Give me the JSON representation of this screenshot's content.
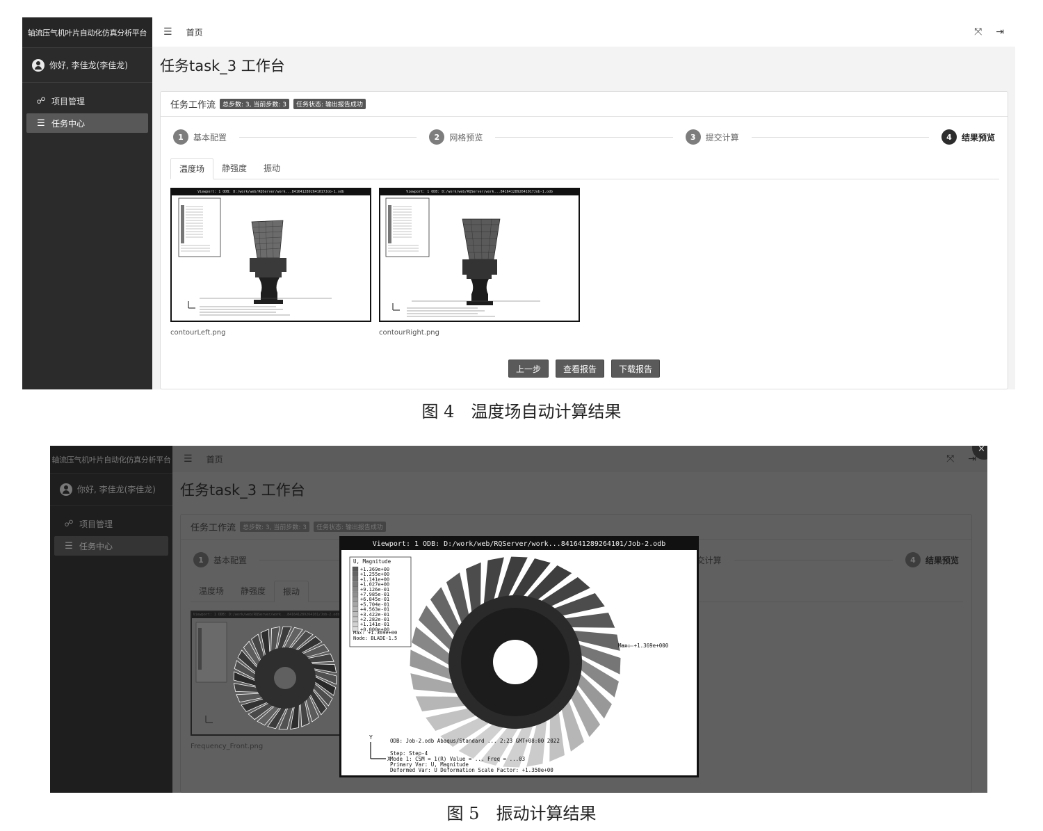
{
  "app": {
    "platform_title": "轴流压气机叶片自动化仿真分析平台",
    "user_greeting": "你好, 李佳龙(李佳龙)",
    "menu": [
      {
        "label": "项目管理",
        "icon": "tree-structure-icon"
      },
      {
        "label": "任务中心",
        "icon": "list-icon"
      }
    ],
    "topbar": {
      "home_label": "首页",
      "menu_icon": "hamburger-icon",
      "fullscreen_icon": "fullscreen-icon",
      "logout_icon": "logout-icon"
    },
    "page_title": "任务task_3 工作台",
    "workflow": {
      "title": "任务工作流",
      "badge_steps": "总步数: 3, 当前步数: 3",
      "badge_status": "任务状态: 输出报告成功"
    },
    "steps": [
      {
        "num": "1",
        "label": "基本配置"
      },
      {
        "num": "2",
        "label": "网格预览"
      },
      {
        "num": "3",
        "label": "提交计算"
      },
      {
        "num": "4",
        "label": "结果预览"
      }
    ],
    "tabs": [
      "温度场",
      "静强度",
      "振动"
    ],
    "buttons": {
      "prev": "上一步",
      "view_report": "查看报告",
      "download_report": "下载报告"
    }
  },
  "figure4": {
    "active_tab": "温度场",
    "images": [
      {
        "caption": "contourLeft.png",
        "viewport": "Viewport: 1    ODB: D:/work/web/RQServer/work...8416412892641017Job-1.odb"
      },
      {
        "caption": "contourRight.png",
        "viewport": "Viewport: 1    ODB: D:/work/web/RQServer/work...8416412892641017Job-1.odb"
      }
    ],
    "caption": "图 4　温度场自动计算结果"
  },
  "figure5": {
    "active_tab": "振动",
    "thumb_caption": "Frequency_Front.png",
    "close_label": "×",
    "modal": {
      "viewport": "Viewport: 1    ODB: D:/work/web/RQServer/work...841641289264101/Job-2.odb",
      "legend_title": "U, Magnitude",
      "legend_values": [
        "+1.369e+00",
        "+1.255e+00",
        "+1.141e+00",
        "+1.027e+00",
        "+9.126e-01",
        "+7.985e-01",
        "+6.845e-01",
        "+5.704e-01",
        "+4.563e-01",
        "+3.422e-01",
        "+2.282e-01",
        "+1.141e-01",
        "+0.000e+00"
      ],
      "legend_max": "Max: +1.369e+00",
      "legend_node": "Node: BLADE-1.5",
      "max_label": "Max: +1.369e+000",
      "info_line1": "ODB: Job-2.odb    Abaqus/Standard ...          2:23 GMT+08:00 2022",
      "info_line2": "Step: Step-4",
      "info_line3": "Mode       1: CSM =   1(R) Value = ...   Freq = ...03",
      "info_line4": "Primary Var: U, Magnitude",
      "info_line5": "Deformed Var: U   Deformation Scale Factor: +1.350e+00"
    },
    "caption": "图 5　振动计算结果"
  }
}
